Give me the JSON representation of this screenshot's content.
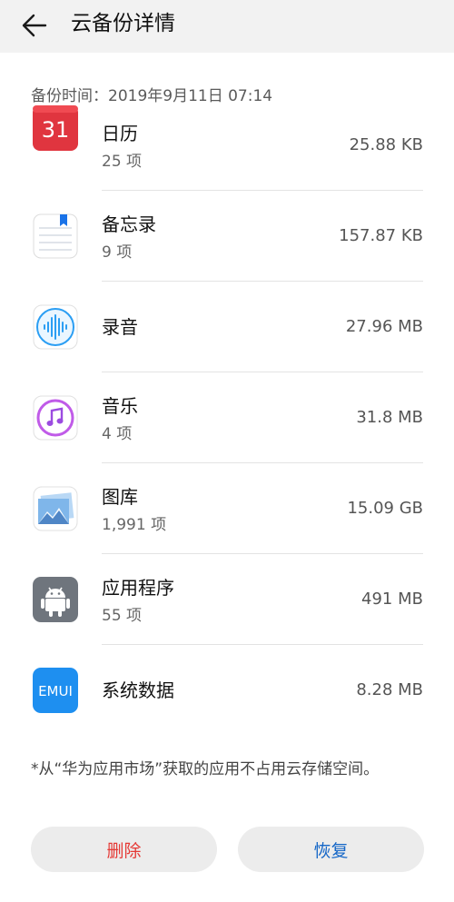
{
  "header": {
    "title": "云备份详情"
  },
  "backup_time": "备份时间：2019年9月11日 07:14",
  "items": [
    {
      "icon": "calendar-icon",
      "name": "日历",
      "count": "25 项",
      "size": "25.88 KB",
      "icon_text": "31"
    },
    {
      "icon": "memo-icon",
      "name": "备忘录",
      "count": "9 项",
      "size": "157.87 KB"
    },
    {
      "icon": "recorder-icon",
      "name": "录音",
      "count": "",
      "size": "27.96 MB"
    },
    {
      "icon": "music-icon",
      "name": "音乐",
      "count": "4 项",
      "size": "31.8 MB"
    },
    {
      "icon": "gallery-icon",
      "name": "图库",
      "count": "1,991 项",
      "size": "15.09 GB"
    },
    {
      "icon": "android-icon",
      "name": "应用程序",
      "count": "55 项",
      "size": "491 MB"
    },
    {
      "icon": "emui-icon",
      "name": "系统数据",
      "count": "",
      "size": "8.28 MB",
      "icon_text": "EMUI"
    }
  ],
  "note": "*从“华为应用市场”获取的应用不占用云存储空间。",
  "buttons": {
    "delete": "删除",
    "restore": "恢复"
  },
  "colors": {
    "delete": "#e53935",
    "restore": "#1466c7",
    "calendar": "#e0353f",
    "emui": "#1e8ff0"
  }
}
